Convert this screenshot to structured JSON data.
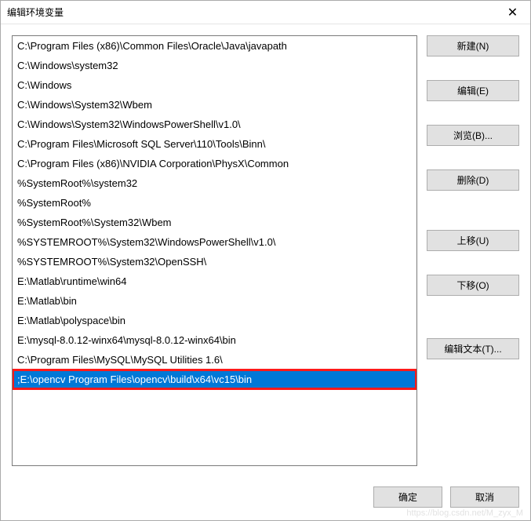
{
  "title": "编辑环境变量",
  "close_glyph": "✕",
  "paths": [
    "C:\\Program Files (x86)\\Common Files\\Oracle\\Java\\javapath",
    "C:\\Windows\\system32",
    "C:\\Windows",
    "C:\\Windows\\System32\\Wbem",
    "C:\\Windows\\System32\\WindowsPowerShell\\v1.0\\",
    "C:\\Program Files\\Microsoft SQL Server\\110\\Tools\\Binn\\",
    "C:\\Program Files (x86)\\NVIDIA Corporation\\PhysX\\Common",
    "%SystemRoot%\\system32",
    "%SystemRoot%",
    "%SystemRoot%\\System32\\Wbem",
    "%SYSTEMROOT%\\System32\\WindowsPowerShell\\v1.0\\",
    "%SYSTEMROOT%\\System32\\OpenSSH\\",
    "E:\\Matlab\\runtime\\win64",
    "E:\\Matlab\\bin",
    "E:\\Matlab\\polyspace\\bin",
    "E:\\mysql-8.0.12-winx64\\mysql-8.0.12-winx64\\bin",
    "C:\\Program Files\\MySQL\\MySQL Utilities 1.6\\",
    ";E:\\opencv Program Files\\opencv\\build\\x64\\vc15\\bin"
  ],
  "selected_index": 17,
  "buttons": {
    "new": "新建(N)",
    "edit": "编辑(E)",
    "browse": "浏览(B)...",
    "delete": "删除(D)",
    "move_up": "上移(U)",
    "move_down": "下移(O)",
    "edit_text": "编辑文本(T)..."
  },
  "footer": {
    "ok": "确定",
    "cancel": "取消"
  },
  "watermark": "https://blog.csdn.net/M_zyx_M",
  "highlight_color": "#ff1a1a",
  "selection_color": "#0078d7"
}
